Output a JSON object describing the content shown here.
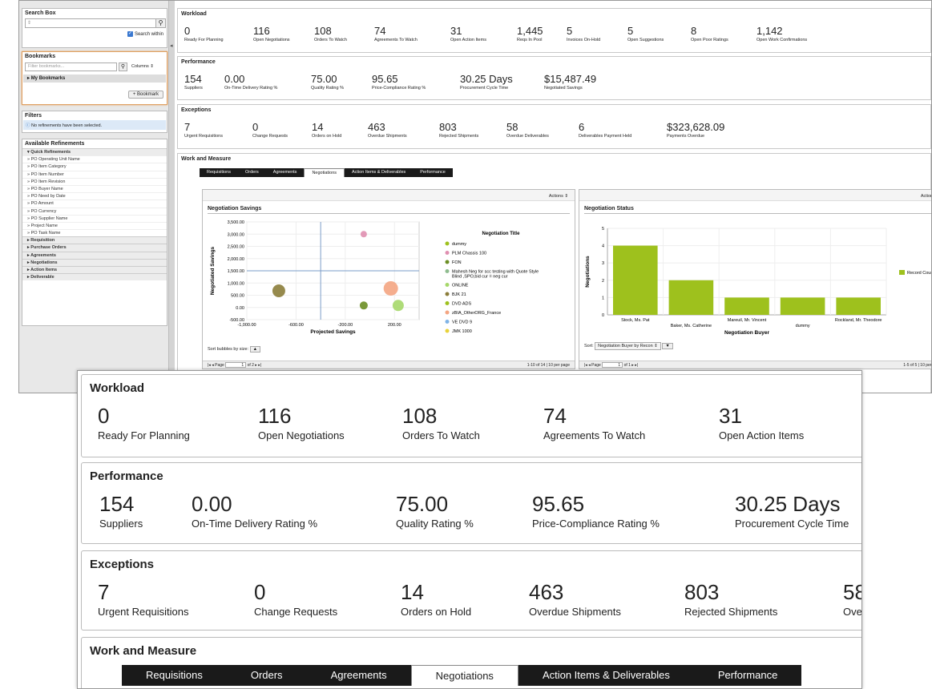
{
  "search": {
    "title": "Search Box",
    "placeholder": "",
    "within": "Search within"
  },
  "bookmarks": {
    "title": "Bookmarks",
    "placeholder": "Filter bookmarks...",
    "columns": "Columns",
    "my": "My Bookmarks",
    "add": "+ Bookmark"
  },
  "filters": {
    "title": "Filters",
    "msg": "No refinements have been selected."
  },
  "refinements": {
    "title": "Available Refinements",
    "quick": "Quick Refinements",
    "items": [
      "PO Operating Unit Name",
      "PO Item Category",
      "PO Item Number",
      "PO Item Revision",
      "PO Buyer Name",
      "PO Need by Date",
      "PO Amount",
      "PO Currency",
      "PO Supplier Name",
      "Project Name",
      "PO Task Name"
    ],
    "groups": [
      "Requisition",
      "Purchase Orders",
      "Agreements",
      "Negotiations",
      "Action Items",
      "Deliverable"
    ]
  },
  "workload": {
    "title": "Workload",
    "items": [
      {
        "v": "0",
        "l": "Ready For Planning"
      },
      {
        "v": "116",
        "l": "Open Negotiations"
      },
      {
        "v": "108",
        "l": "Orders To Watch"
      },
      {
        "v": "74",
        "l": "Agreements To Watch"
      },
      {
        "v": "31",
        "l": "Open Action Items"
      },
      {
        "v": "1,445",
        "l": "Reqs In Pool"
      },
      {
        "v": "5",
        "l": "Invoices On-Hold"
      },
      {
        "v": "5",
        "l": "Open Suggestions"
      },
      {
        "v": "8",
        "l": "Open Poor Ratings"
      },
      {
        "v": "1,142",
        "l": "Open Work Confirmations"
      }
    ]
  },
  "performance": {
    "title": "Performance",
    "items": [
      {
        "v": "154",
        "l": "Suppliers"
      },
      {
        "v": "0.00",
        "l": "On-Time Delivery Rating %"
      },
      {
        "v": "75.00",
        "l": "Quality Rating %"
      },
      {
        "v": "95.65",
        "l": "Price-Compliance Rating %"
      },
      {
        "v": "30.25 Days",
        "l": "Procurement Cycle Time"
      },
      {
        "v": "$15,487.49",
        "l": "Negotiated Savings"
      }
    ]
  },
  "exceptions": {
    "title": "Exceptions",
    "items": [
      {
        "v": "7",
        "l": "Urgent Requisitions"
      },
      {
        "v": "0",
        "l": "Change Requests"
      },
      {
        "v": "14",
        "l": "Orders on Hold"
      },
      {
        "v": "463",
        "l": "Overdue Shipments"
      },
      {
        "v": "803",
        "l": "Rejected Shipments"
      },
      {
        "v": "58",
        "l": "Overdue Deliverables"
      },
      {
        "v": "6",
        "l": "Deliverables Payment Held"
      },
      {
        "v": "$323,628.09",
        "l": "Payments Overdue"
      }
    ]
  },
  "work": {
    "title": "Work and Measure",
    "tabs": [
      "Requisitions",
      "Orders",
      "Agreements",
      "Negotiations",
      "Action Items & Deliverables",
      "Performance"
    ],
    "active": 3
  },
  "actions": "Actions",
  "chart1": {
    "title": "Negotiation Savings",
    "ylabel": "Negotiated Savings",
    "xlabel": "Projected Savings",
    "legend_title": "Negotiation Title",
    "sort_label": "Sort bubbles by size:",
    "page": "Page",
    "page_val": "1",
    "page_of": "of 2",
    "page_info": "1-10 of 14  |  10 per page"
  },
  "chart2": {
    "title": "Negotiation Status",
    "ylabel": "Negotiations",
    "xlabel": "Negotiation Buyer",
    "legend": "Record Count",
    "sort_label": "Sort:",
    "sort_value": "Negotiation Buyer by Recon",
    "page": "Page",
    "page_val": "1",
    "page_of": "of 1",
    "page_info": "1-5 of 5  |  10 per page"
  },
  "chart_data": [
    {
      "type": "scatter",
      "title": "Negotiation Savings",
      "xlabel": "Projected Savings",
      "ylabel": "Negotiated Savings",
      "xlim": [
        -1000,
        400
      ],
      "ylim": [
        -500,
        3500
      ],
      "xticks": [
        "-1,000.00",
        "-600.00",
        "-200.00",
        "200.00"
      ],
      "yticks": [
        "3,500.00",
        "3,000.00",
        "2,500.00",
        "2,000.00",
        "1,500.00",
        "1,000.00",
        "500.00",
        "0.00",
        "-500.00"
      ],
      "series": [
        {
          "name": "dummy",
          "color": "#9ec11d",
          "points": []
        },
        {
          "name": "PLM Chassis 100",
          "color": "#e08fb0",
          "points": [
            {
              "x": -50,
              "y": 3000,
              "r": 4
            }
          ]
        },
        {
          "name": "FON",
          "color": "#6b8e23",
          "points": [
            {
              "x": -50,
              "y": 80,
              "r": 5
            }
          ]
        },
        {
          "name": "Mahesh Neg for scc testing with Quote Style Blind ,SPO,bid cur = neg cur",
          "color": "#8fbc8f",
          "points": []
        },
        {
          "name": "ONLINE",
          "color": "#a6d86a",
          "points": [
            {
              "x": 230,
              "y": 80,
              "r": 7
            }
          ]
        },
        {
          "name": "BJK 21",
          "color": "#8b7d3a",
          "points": [
            {
              "x": -740,
              "y": 680,
              "r": 8
            }
          ]
        },
        {
          "name": "DVD ADS",
          "color": "#9ec11d",
          "points": []
        },
        {
          "name": "zBIA_OtherORG_France",
          "color": "#f4a582",
          "points": [
            {
              "x": 170,
              "y": 780,
              "r": 9
            }
          ]
        },
        {
          "name": "VE DVD 9",
          "color": "#7fb3e6",
          "points": []
        },
        {
          "name": "JMK 1000",
          "color": "#e8d23a",
          "points": []
        }
      ]
    },
    {
      "type": "bar",
      "title": "Negotiation Status",
      "xlabel": "Negotiation Buyer",
      "ylabel": "Negotiations",
      "ylim": [
        0,
        5
      ],
      "categories": [
        "Stock, Ms. Pat",
        "Baker, Ms. Catherine",
        "Mareuil, Mr. Vincent",
        "dummy",
        "Rockland, Mr. Theodore"
      ],
      "series": [
        {
          "name": "Record Count",
          "values": [
            4,
            2,
            1,
            1,
            1
          ],
          "color": "#9ec11d"
        }
      ]
    }
  ]
}
